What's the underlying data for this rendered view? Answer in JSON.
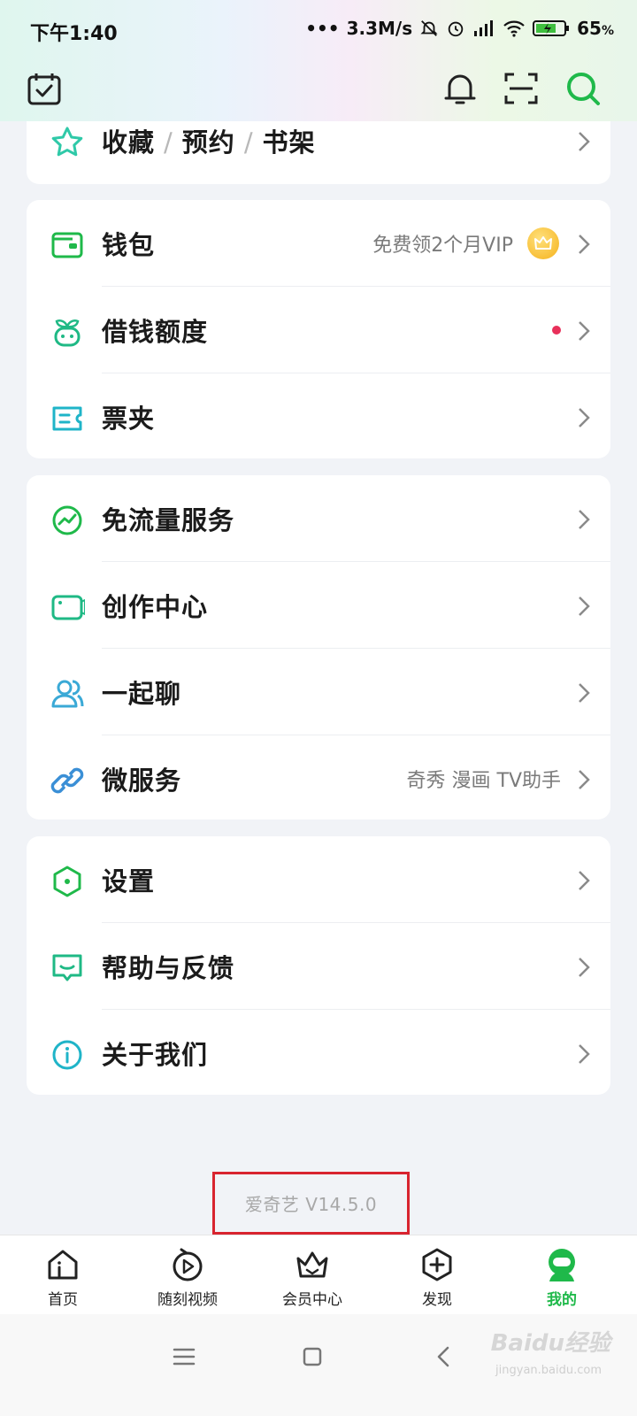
{
  "status": {
    "time": "下午1:40",
    "speed": "3.3M/s",
    "battery": "65"
  },
  "header": {
    "icons": [
      "calendar-check-icon",
      "bell-icon",
      "scan-icon",
      "search-icon"
    ]
  },
  "favorites": {
    "parts": [
      "收藏",
      "预约",
      "书架"
    ],
    "sep": "/"
  },
  "group1": {
    "wallet": {
      "label": "钱包",
      "aux": "免费领2个月VIP"
    },
    "loan": {
      "label": "借钱额度"
    },
    "tickets": {
      "label": "票夹"
    }
  },
  "group2": {
    "dataFree": {
      "label": "免流量服务"
    },
    "creator": {
      "label": "创作中心"
    },
    "chat": {
      "label": "一起聊"
    },
    "micro": {
      "label": "微服务",
      "aux": "奇秀 漫画 TV助手"
    }
  },
  "group3": {
    "settings": {
      "label": "设置"
    },
    "help": {
      "label": "帮助与反馈"
    },
    "about": {
      "label": "关于我们"
    }
  },
  "version": "爱奇艺 V14.5.0",
  "tabs": {
    "home": "首页",
    "video": "随刻视频",
    "vip": "会员中心",
    "discover": "发现",
    "me": "我的"
  },
  "colors": {
    "accent": "#1fb94a",
    "highlight_box": "#d8242f",
    "notification_dot": "#e8305a"
  },
  "watermark": {
    "brand": "Baidu经验",
    "url": "jingyan.baidu.com"
  }
}
